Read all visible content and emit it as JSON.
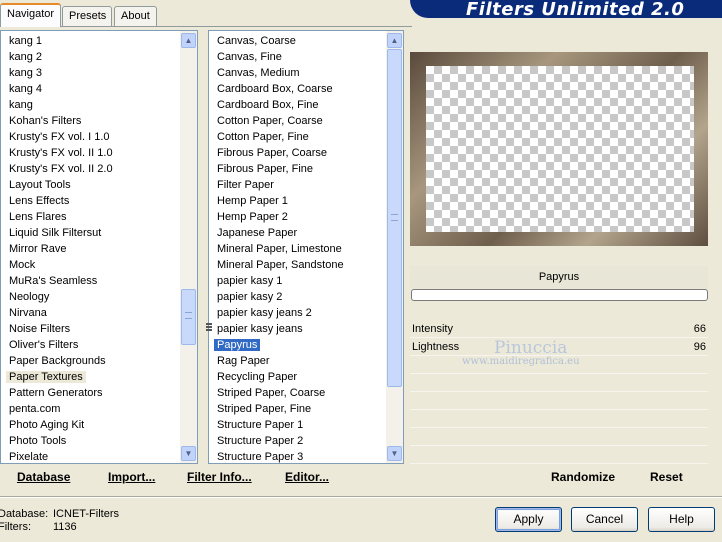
{
  "tabs": [
    "Navigator",
    "Presets",
    "About"
  ],
  "banner_title": "Filters Unlimited 2.0",
  "categories": [
    "kang 1",
    "kang 2",
    "kang 3",
    "kang 4",
    "kang",
    "Kohan's Filters",
    "Krusty's FX vol. I 1.0",
    "Krusty's FX vol. II 1.0",
    "Krusty's FX vol. II 2.0",
    "Layout Tools",
    "Lens Effects",
    "Lens Flares",
    "Liquid Silk Filtersut",
    "Mirror Rave",
    "Mock",
    "MuRa's Seamless",
    "Neology",
    "Nirvana",
    "Noise Filters",
    "Oliver's Filters",
    "Paper Backgrounds",
    "Paper Textures",
    "Pattern Generators",
    "penta.com",
    "Photo Aging Kit",
    "Photo Tools",
    "Pixelate"
  ],
  "selected_category": "Paper Textures",
  "filters": [
    "Canvas, Coarse",
    "Canvas, Fine",
    "Canvas, Medium",
    "Cardboard Box, Coarse",
    "Cardboard Box, Fine",
    "Cotton Paper, Coarse",
    "Cotton Paper, Fine",
    "Fibrous Paper, Coarse",
    "Fibrous Paper, Fine",
    "Filter Paper",
    "Hemp Paper 1",
    "Hemp Paper 2",
    "Japanese Paper",
    "Mineral Paper, Limestone",
    "Mineral Paper, Sandstone",
    "papier kasy 1",
    "papier kasy 2",
    "papier kasy jeans 2",
    "papier kasy jeans",
    "Papyrus",
    "Rag Paper",
    "Recycling Paper",
    "Striped Paper, Coarse",
    "Striped Paper, Fine",
    "Structure Paper 1",
    "Structure Paper 2",
    "Structure Paper 3"
  ],
  "selected_filter": "Papyrus",
  "filter_name": "Papyrus",
  "params": [
    {
      "label": "Intensity",
      "value": "66"
    },
    {
      "label": "Lightness",
      "value": "96"
    }
  ],
  "watermark": {
    "line1": "Pinuccia",
    "line2": "www.maidiregrafica.eu"
  },
  "bottom_links": {
    "database": "Database",
    "import": "Import...",
    "filter_info": "Filter Info...",
    "editor": "Editor...",
    "randomize": "Randomize",
    "reset": "Reset"
  },
  "footer_info": {
    "database_label": "Database:",
    "database_value": "ICNET-Filters",
    "filters_label": "Filters:",
    "filters_value": "1136"
  },
  "buttons": {
    "apply": "Apply",
    "cancel": "Cancel",
    "help": "Help"
  },
  "icons": {
    "scroll_up": "up-arrow-icon",
    "scroll_down": "down-arrow-icon"
  }
}
